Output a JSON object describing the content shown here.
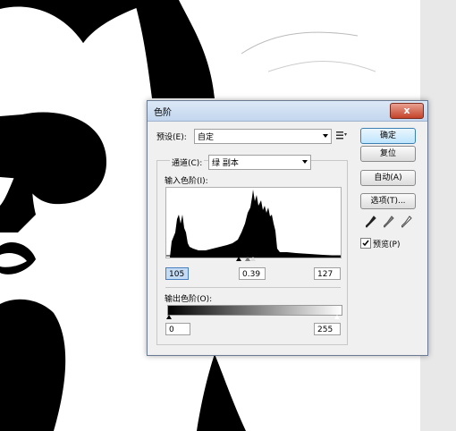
{
  "dialog": {
    "title": "色阶",
    "close_glyph": "x",
    "preset_label": "预设(E):",
    "preset_value": "自定",
    "channel_label": "通道(C):",
    "channel_value": "绿 副本",
    "input_levels_label": "输入色阶(I):",
    "output_levels_label": "输出色阶(O):",
    "input_black": "105",
    "input_gamma": "0.39",
    "input_white": "127",
    "output_black": "0",
    "output_white": "255",
    "preview_label": "预览(P)",
    "preview_checked": true
  },
  "buttons": {
    "ok": "确定",
    "reset": "复位",
    "auto": "自动(A)",
    "options": "选项(T)..."
  },
  "icons": [
    "preset-menu-icon",
    "black-eyedropper-icon",
    "gray-eyedropper-icon",
    "white-eyedropper-icon",
    "close-icon"
  ],
  "colors": {
    "title_bar": "#c3d6ee",
    "close_button": "#c4432a",
    "default_button": "#bee6fd",
    "selected_field": "#c5dcf5"
  }
}
